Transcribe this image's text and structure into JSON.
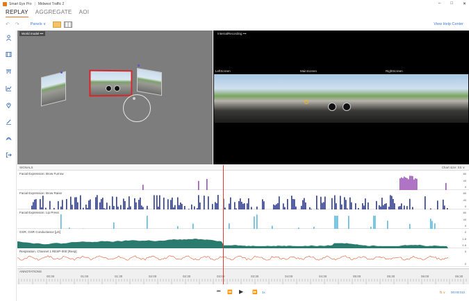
{
  "window": {
    "app_title": "Smart Eye Pro",
    "separator": "|",
    "project": "Midwest Traffic 2",
    "btn_min": "–",
    "btn_max": "□",
    "btn_close": "✕"
  },
  "mode_tabs": [
    {
      "label": "REPLAY",
      "active": true
    },
    {
      "label": "AGGREGATE",
      "active": false
    },
    {
      "label": "AOI",
      "active": false
    }
  ],
  "toolbar": {
    "undo": "↶",
    "redo": "↷",
    "panels_label": "Panels  ∨",
    "help_label": "View Help Center"
  },
  "sidebar": {
    "icons": [
      "person-icon",
      "film-icon",
      "timeline-icon",
      "chart-icon",
      "location-icon",
      "pen-icon",
      "bookmark-icon",
      "export-icon"
    ]
  },
  "world_panel": {
    "label": "World model  •••"
  },
  "recording_panel": {
    "label": "InternalRecording  •••",
    "cameras": [
      "LeftScreen",
      "MainScreen",
      "RightScreen"
    ]
  },
  "signals": {
    "header": "SIGNALS",
    "chart_size": "Chart size: XS ∨",
    "rows": [
      {
        "title": "Facial Expression: Brow Furrow",
        "color": "#9b52b8",
        "scale_top": "80",
        "scale_mid": "40",
        "scale_bot": "0"
      },
      {
        "title": "Facial Expression: Brow Raise",
        "color": "#2c3a8f",
        "scale_top": "80",
        "scale_mid": "40",
        "scale_bot": "0"
      },
      {
        "title": "Facial Expression: Lip Press",
        "color": "#5bb9e0",
        "scale_top": "80",
        "scale_mid": "40",
        "scale_bot": "0"
      },
      {
        "title": "GSR, GSR Conductance [μS]",
        "color": "#2a7a6e",
        "scale_top": "2",
        "scale_mid": "1.8",
        "scale_bot": "1.6"
      },
      {
        "title": "Respiration, Channel 1 RESP-000 [Resp]",
        "color": "#e0582a",
        "scale_top": "0",
        "scale_mid": "",
        "scale_bot": "0"
      }
    ]
  },
  "annotations": {
    "header": "ANNOTATIONS",
    "ticks": [
      "00:30",
      "01:00",
      "01:30",
      "02:00",
      "02:30",
      "03:00",
      "03:30",
      "04:00",
      "04:30",
      "05:00",
      "05:30",
      "06:00",
      "06:30"
    ]
  },
  "playback": {
    "skip_back": "⏮",
    "step_back": "⏪",
    "play": "▶",
    "step_fwd": "⏩",
    "speed": "1x",
    "zoom": "⇅ ∨",
    "time": "00:03:010"
  },
  "colors": {
    "accent": "#e07a1c",
    "cursor": "#e8392e",
    "link": "#3a7bd5"
  }
}
